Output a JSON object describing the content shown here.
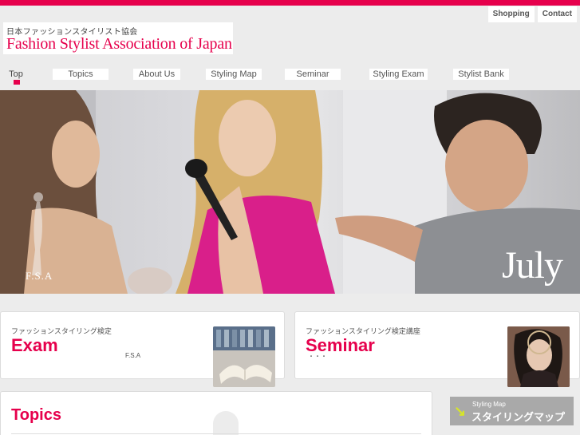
{
  "header": {
    "util_nav": [
      "Shopping",
      "Contact"
    ],
    "logo_sub": "日本ファッションスタイリスト協会",
    "logo_main": "Fashion Stylist Association of Japan"
  },
  "nav": {
    "items": [
      "Top",
      "Topics",
      "About Us",
      "Styling Map",
      "Seminar",
      "Styling Exam",
      "Stylist Bank"
    ],
    "active": "Top"
  },
  "hero": {
    "month": "July",
    "watermark": "F.S.A"
  },
  "cards": [
    {
      "kicker": "ファッションスタイリング検定",
      "title": "Exam",
      "note": "F.S.A",
      "thumb_icon": "open-book-icon"
    },
    {
      "kicker": "ファッションスタイリング検定講座",
      "title": "Seminar",
      "note": "・・・",
      "thumb_icon": "portrait-icon"
    }
  ],
  "topics": {
    "title": "Topics"
  },
  "side_banner": {
    "en": "Styling Map",
    "jp": "スタイリングマップ",
    "icon": "arrow-down-right-icon"
  },
  "colors": {
    "accent": "#e6004c",
    "background": "#ececec",
    "banner": "#a9a9a9",
    "arrow": "#d6e52a"
  }
}
